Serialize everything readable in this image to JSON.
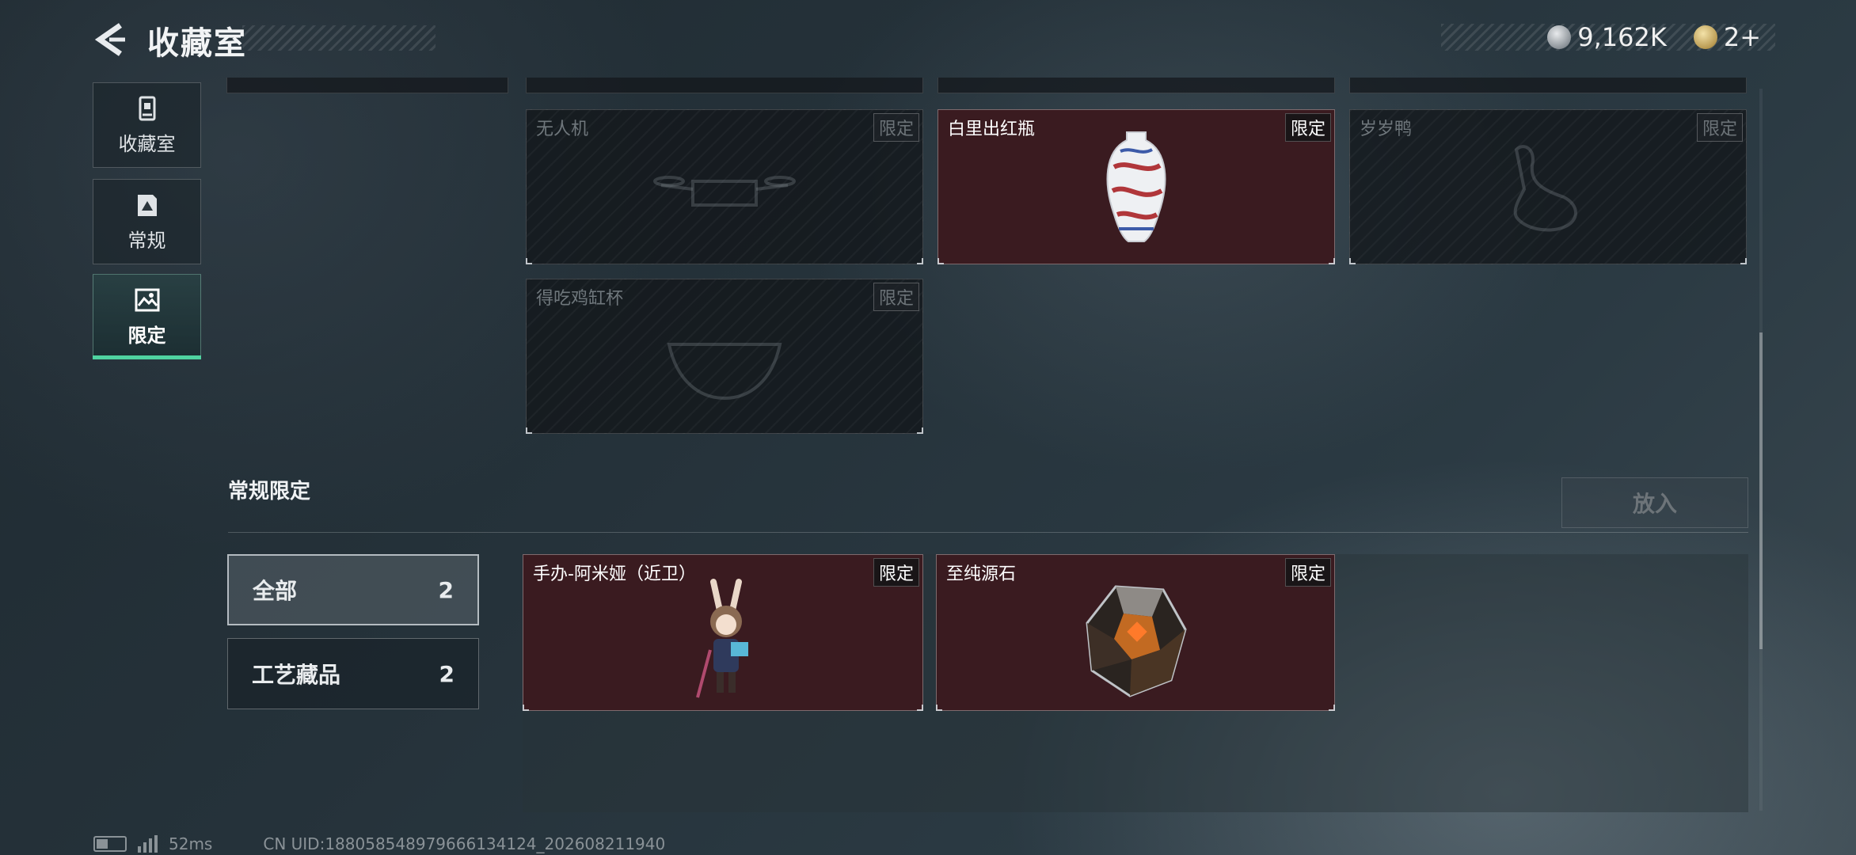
{
  "header": {
    "title": "收藏室",
    "currency_value": "9,162K",
    "ticket_value": "2+"
  },
  "sidebar": {
    "items": [
      {
        "label": "收藏室",
        "icon": "collection-room-icon"
      },
      {
        "label": "常规",
        "icon": "regular-book-icon"
      },
      {
        "label": "限定",
        "icon": "limited-image-icon"
      }
    ],
    "active": "限定"
  },
  "top_cards": [
    {
      "name": "无人机",
      "tag": "限定",
      "owned": false
    },
    {
      "name": "白里出红瓶",
      "tag": "限定",
      "owned": true
    },
    {
      "name": "岁岁鸭",
      "tag": "限定",
      "owned": false
    },
    {
      "name": "得吃鸡缸杯",
      "tag": "限定",
      "owned": false
    }
  ],
  "section": {
    "title": "常规限定",
    "put_button": "放入"
  },
  "filters": [
    {
      "label": "全部",
      "count": "2",
      "active": true
    },
    {
      "label": "工艺藏品",
      "count": "2",
      "active": false
    }
  ],
  "section_cards": [
    {
      "name": "手办-阿米娅（近卫）",
      "tag": "限定",
      "owned": true
    },
    {
      "name": "至纯源石",
      "tag": "限定",
      "owned": true
    }
  ],
  "footer": {
    "ping": "52ms",
    "uid": "CN UID:1880585489796661341​24_202608211940"
  },
  "colors": {
    "accent": "#4fd3a0",
    "owned_card_bg": "#3a1b20"
  }
}
